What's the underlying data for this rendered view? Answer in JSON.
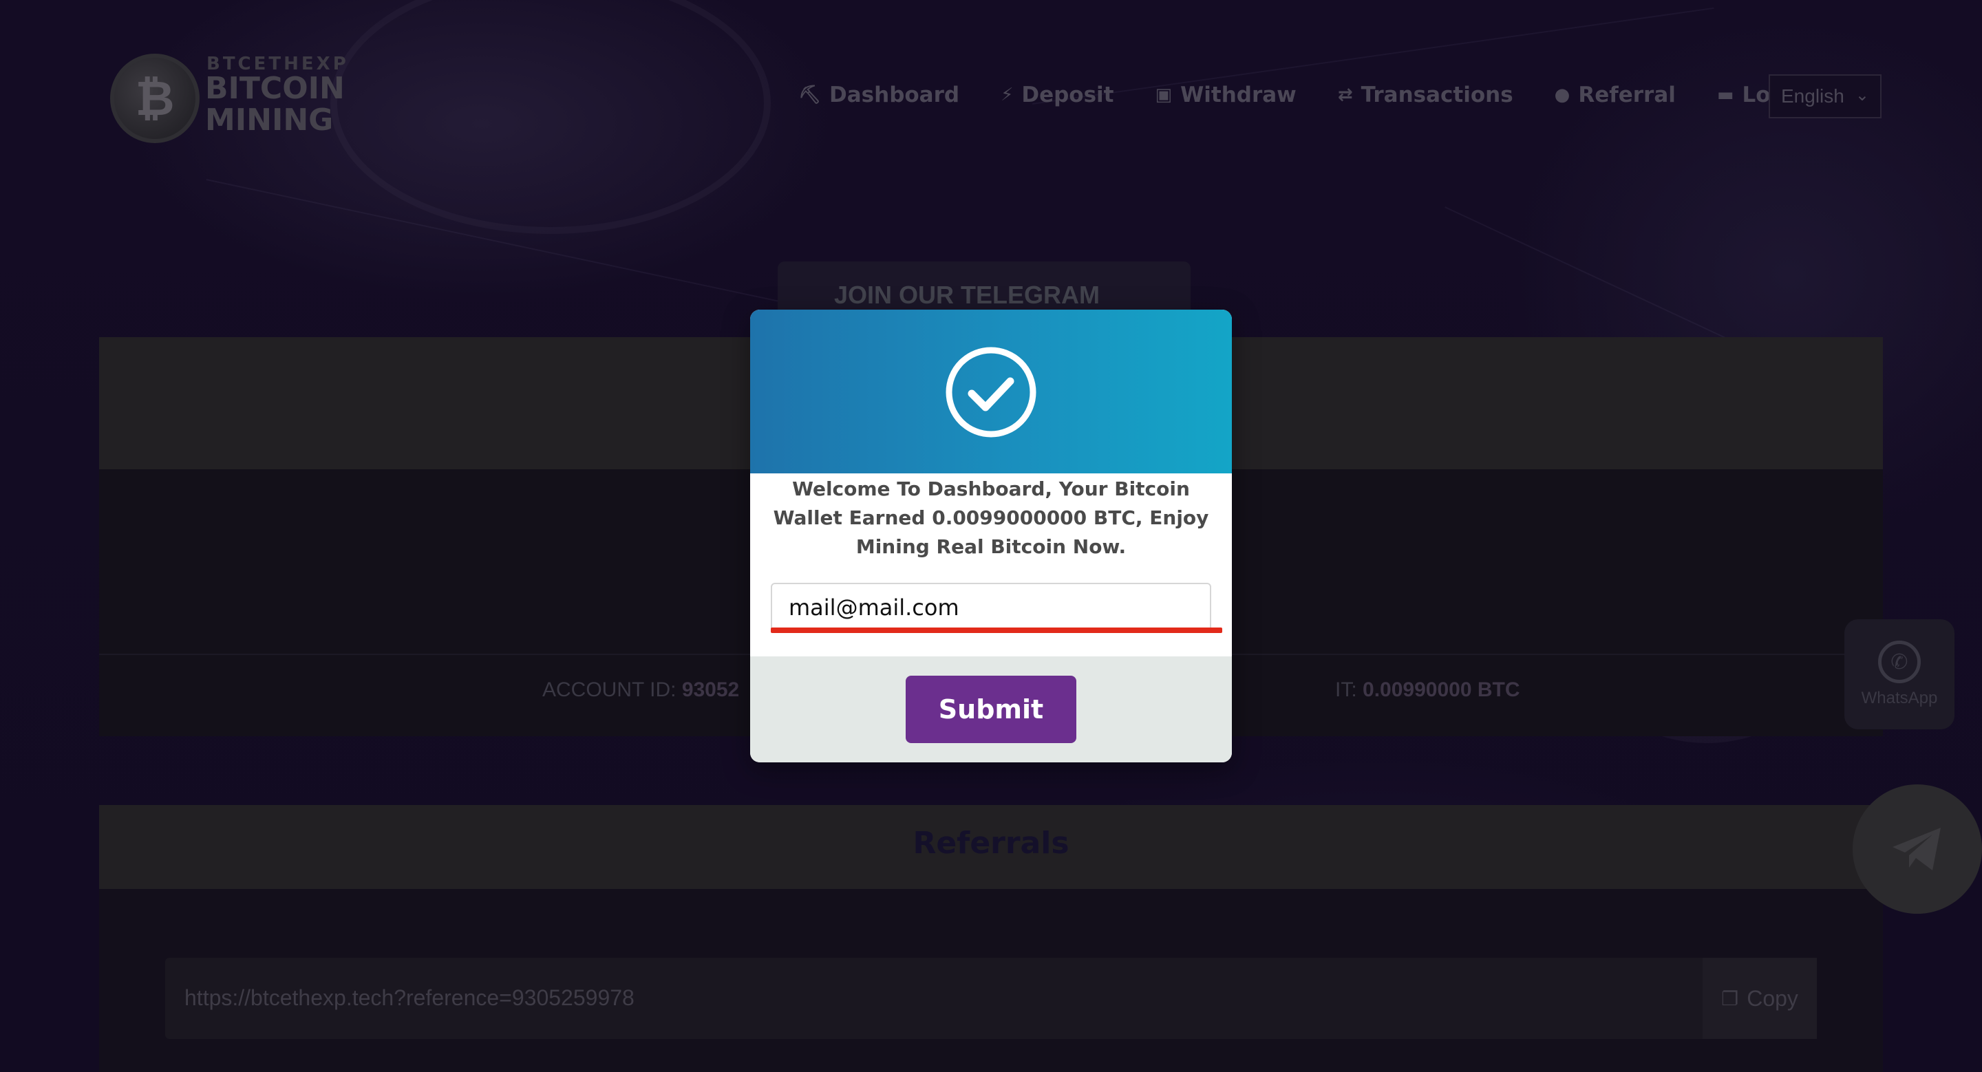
{
  "header": {
    "logo_small": "BTCETHEXP",
    "logo_line1": "BITCOIN",
    "logo_line2": "MINING",
    "nav": [
      {
        "label": "Dashboard",
        "icon": "pickaxe-icon"
      },
      {
        "label": "Deposit",
        "icon": "lightning-icon"
      },
      {
        "label": "Withdraw",
        "icon": "cash-icon"
      },
      {
        "label": "Transactions",
        "icon": "exchange-icon"
      },
      {
        "label": "Referral",
        "icon": "user-icon"
      },
      {
        "label": "Logout",
        "icon": "logout-icon"
      }
    ],
    "language": "English"
  },
  "telegram_banner": "JOIN OUR TELEGRAM",
  "dashboard": {
    "account_id_label": "ACCOUNT ID:",
    "account_id_value": "93052",
    "deposit_label": "IT:",
    "deposit_value": "0.00990000 BTC"
  },
  "referrals": {
    "title": "Referrals",
    "link": "https://btcethexp.tech?reference=9305259978",
    "copy_label": "Copy"
  },
  "floating": {
    "whatsapp_label": "WhatsApp"
  },
  "modal": {
    "message": "Welcome To Dashboard, Your Bitcoin Wallet Earned 0.0099000000 BTC, Enjoy Mining Real Bitcoin Now.",
    "email_value": "mail@mail.com",
    "submit_label": "Submit",
    "header_color": "#1a8fbe",
    "submit_color": "#6b2f8e",
    "highlight_color": "#e22a1a"
  }
}
